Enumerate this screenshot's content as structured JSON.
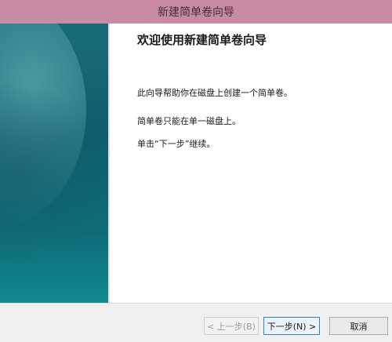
{
  "window": {
    "title": "新建简单卷向导"
  },
  "wizard": {
    "heading": "欢迎使用新建简单卷向导",
    "paragraphs": [
      "此向导帮助你在磁盘上创建一个简单卷。",
      "简单卷只能在单一磁盘上。",
      "单击“下一步”继续。"
    ]
  },
  "buttons": {
    "back": "< 上一步(B)",
    "next": "下一步(N) >",
    "cancel": "取消"
  }
}
